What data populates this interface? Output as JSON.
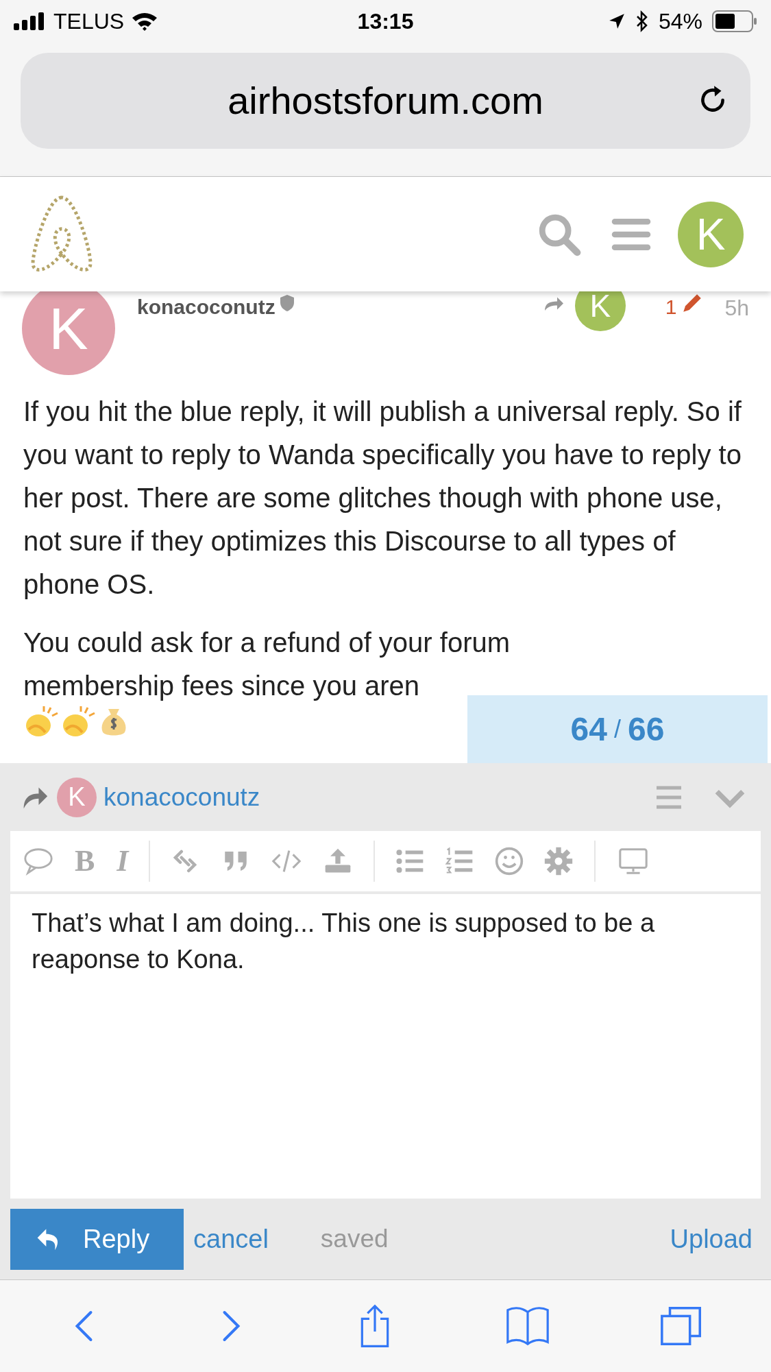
{
  "status_bar": {
    "carrier": "TELUS",
    "time": "13:15",
    "battery": "54%"
  },
  "browser": {
    "url": "airhostsforum.com"
  },
  "site_header": {
    "avatar_letter": "K"
  },
  "post": {
    "avatar_letter": "K",
    "username": "konacoconutz",
    "reply_avatar_letter": "K",
    "edits": "1",
    "age": "5h",
    "paragraphs": [
      "If you hit the blue reply, it will publish a universal reply. So if you want to reply to Wanda specifically you have to reply to her post. There are some glitches though with phone use, not sure if they optimizes this Discourse to all types of phone OS.",
      "You could ask for a refund of your forum membership fees since you aren"
    ]
  },
  "progress": {
    "current": "64",
    "separator": "/",
    "total": "66"
  },
  "composer": {
    "reply_to_letter": "K",
    "reply_to": "konacoconutz",
    "toolbar": {
      "bold": "B",
      "italic": "I"
    },
    "text": "That’s what I am doing... This one is supposed to be a reaponse to Kona.",
    "reply_button": "Reply",
    "cancel": "cancel",
    "status": "saved",
    "upload": "Upload"
  }
}
